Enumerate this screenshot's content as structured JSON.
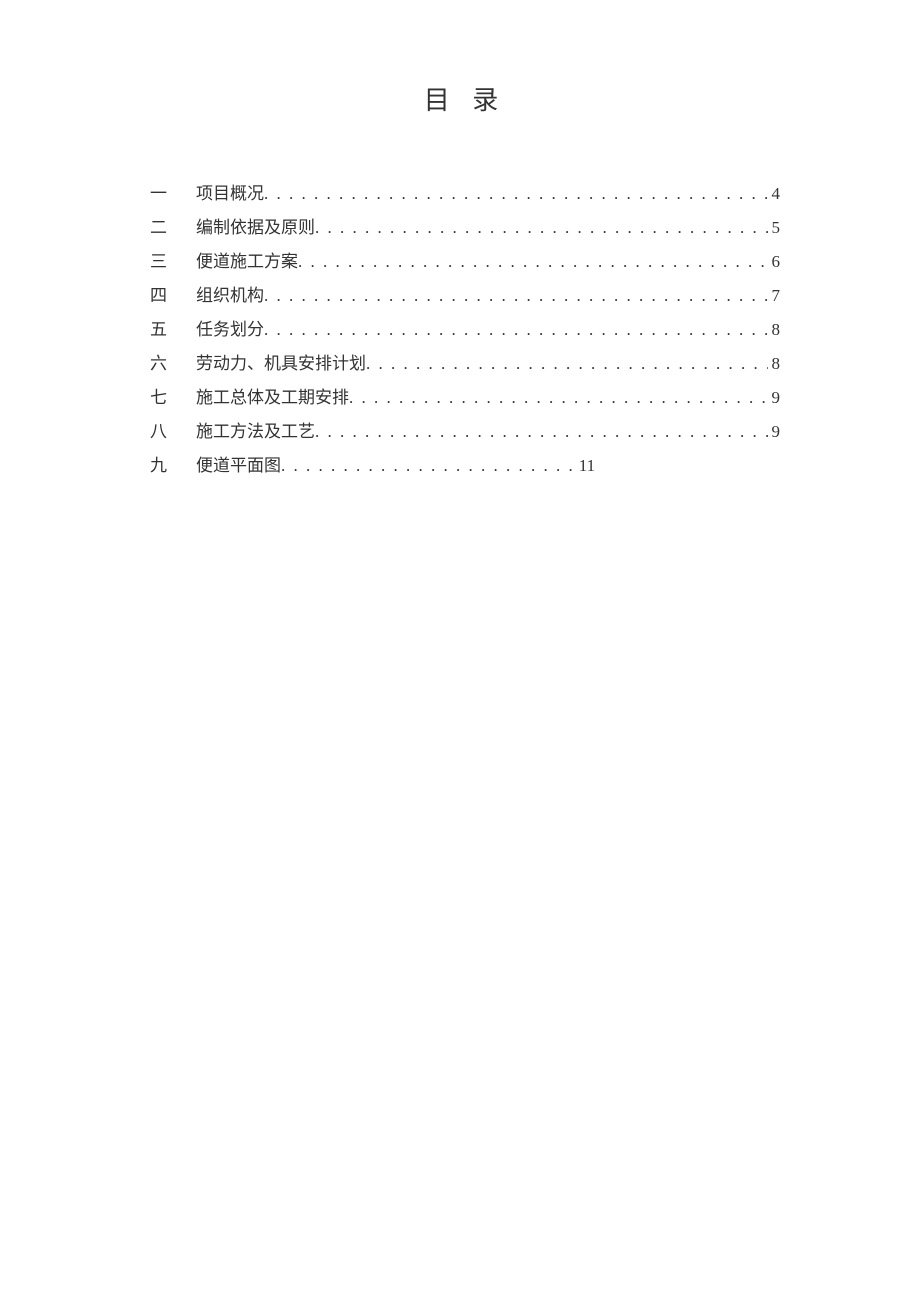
{
  "title": "目 录",
  "toc": {
    "entries": [
      {
        "num": "一",
        "label": "项目概况",
        "page": "4",
        "short": false
      },
      {
        "num": "二",
        "label": "编制依据及原则",
        "page": "5",
        "short": false
      },
      {
        "num": "三",
        "label": "便道施工方案",
        "page": "6",
        "short": false
      },
      {
        "num": "四",
        "label": "组织机构",
        "page": "7",
        "short": false
      },
      {
        "num": "五",
        "label": "任务划分",
        "page": "8",
        "short": false
      },
      {
        "num": "六",
        "label": "劳动力、机具安排计划",
        "page": "8",
        "short": false
      },
      {
        "num": "七",
        "label": "施工总体及工期安排",
        "page": "9",
        "short": false
      },
      {
        "num": "八",
        "label": "施工方法及工艺",
        "page": "9",
        "short": false
      },
      {
        "num": "九",
        "label": "便道平面图",
        "page": "11",
        "short": true
      }
    ]
  },
  "dots_full": ". . . . . . . . . . . . . . . . . . . . . . . . . . . . . . . . . . . . . . . . . . . . . . . . . . . . . . . . . . . . . . . . . . . . . . . . . . . . . . . .",
  "dots_short": ". . . . . . . . . . . . . . . . . . . . . . . ."
}
